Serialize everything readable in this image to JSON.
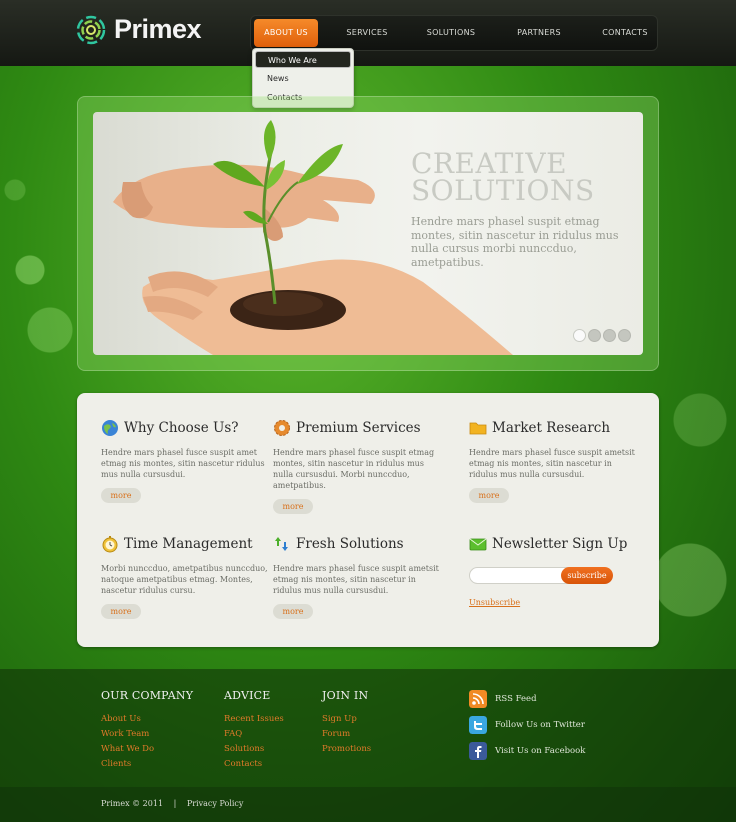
{
  "header": {
    "logo_text": "Primex",
    "nav": [
      "ABOUT US",
      "SERVICES",
      "SOLUTIONS",
      "PARTNERS",
      "CONTACTS"
    ],
    "dropdown": [
      "Who We Are",
      "News",
      "Contacts"
    ]
  },
  "slider": {
    "headline_line1": "CREATIVE",
    "headline_line2": "SOLUTIONS",
    "text": "Hendre mars phasel suspit etmag montes, sitin nascetur in ridulus mus nulla cursus morbi nunccduo, ametpatibus.",
    "active_dot": 1,
    "dot_count": 4
  },
  "features": {
    "why": {
      "title": "Why Choose Us?",
      "text": "Hendre mars phasel fusce suspit amet etmag nis montes, sitin nascetur ridulus mus nulla cursusdui.",
      "more": "more"
    },
    "premium": {
      "title": "Premium Services",
      "text": "Hendre mars phasel fusce suspit etmag montes, sitin nascetur in ridulus mus nulla cursusdui. Morbi nunccduo, ametpatibus.",
      "more": "more"
    },
    "market": {
      "title": "Market Research",
      "text": "Hendre mars phasel fusce suspit ametsit etmag nis montes, sitin nascetur in ridulus mus nulla cursusdui.",
      "more": "more"
    },
    "time": {
      "title": "Time Management",
      "text": "Morbi nunccduo, ametpatibus nunccduo, natoque ametpatibus etmag. Montes, nascetur ridulus cursu.",
      "more": "more"
    },
    "fresh": {
      "title": "Fresh Solutions",
      "text": "Hendre mars phasel fusce suspit ametsit etmag nis montes, sitin nascetur in ridulus mus nulla cursusdui.",
      "more": "more"
    },
    "newsletter": {
      "title": "Newsletter Sign Up",
      "input_value": "",
      "button": "subscribe",
      "unsubscribe": "Unsubscribe"
    }
  },
  "footer": {
    "company": {
      "title": "OUR COMPANY",
      "links": [
        "About Us",
        "Work Team",
        "What We Do",
        "Clients"
      ]
    },
    "advice": {
      "title": "ADVICE",
      "links": [
        "Recent Issues",
        "FAQ",
        "Solutions",
        "Contacts"
      ]
    },
    "join": {
      "title": "JOIN IN",
      "links": [
        "Sign Up",
        "Forum",
        "Promotions"
      ]
    },
    "social": [
      "RSS Feed",
      "Follow Us on Twitter",
      "Visit Us on Facebook"
    ],
    "copyright": "Primex © 2011",
    "separator": "|",
    "privacy": "Privacy Policy"
  },
  "colors": {
    "accent": "#e8701a",
    "dark_header": "#1b1e18",
    "panel": "#efefe9",
    "background_green": "#3a9a1a"
  },
  "icons": [
    "logo-swirl-icon",
    "globe-icon",
    "gear-icon",
    "folder-icon",
    "stopwatch-icon",
    "arrows-icon",
    "envelope-icon",
    "rss-icon",
    "twitter-icon",
    "facebook-icon"
  ]
}
